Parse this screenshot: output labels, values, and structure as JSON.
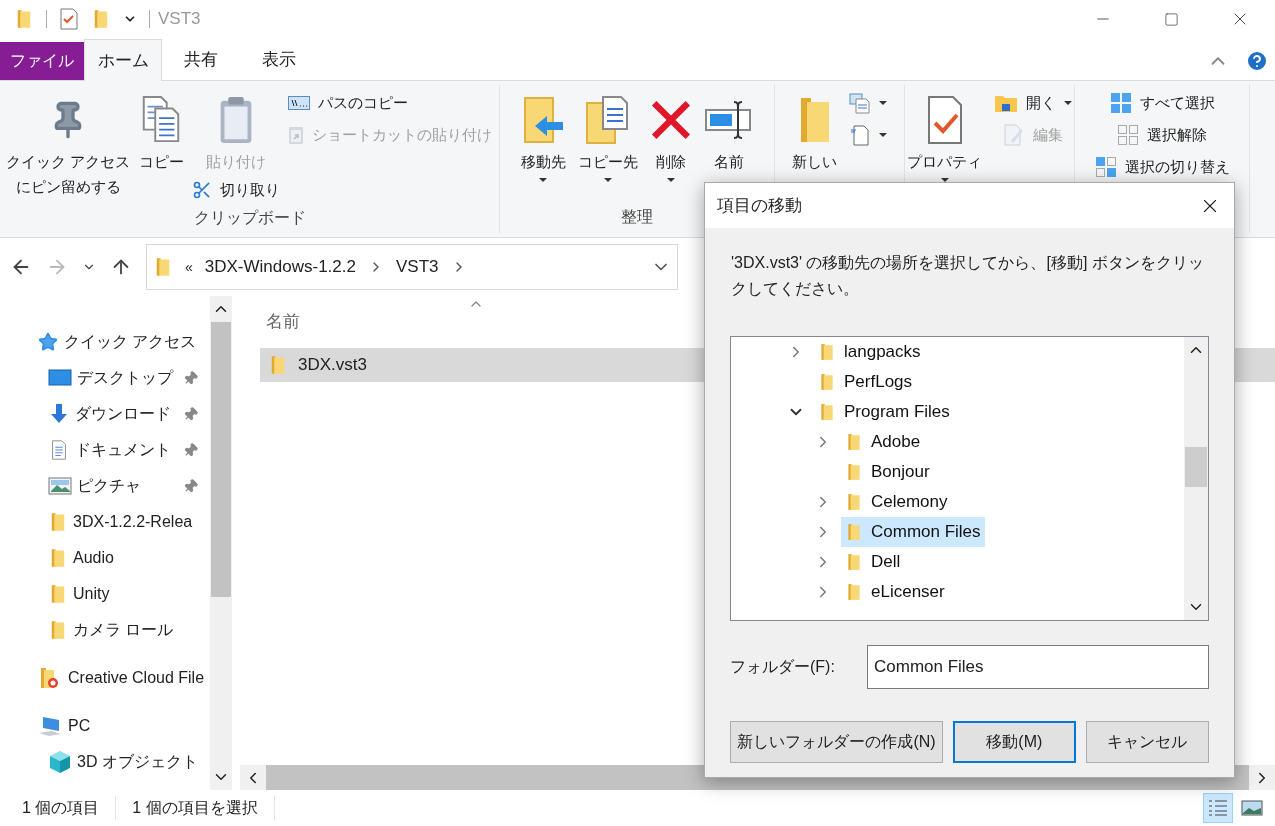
{
  "window": {
    "title": "VST3"
  },
  "tabs": [
    {
      "label": "ファイル",
      "kind": "file",
      "selected": false
    },
    {
      "label": "ホーム",
      "kind": "tab",
      "selected": true
    },
    {
      "label": "共有",
      "kind": "tab",
      "selected": false
    },
    {
      "label": "表示",
      "kind": "tab",
      "selected": false
    }
  ],
  "ribbon": [
    {
      "label": "クリップボード",
      "columns": [
        [
          {
            "kind": "large",
            "lines": [
              "クイック アクセス",
              "にピン留めする"
            ],
            "disabled": false,
            "dropdown": false
          }
        ],
        [
          {
            "kind": "large",
            "lines": [
              "コピー"
            ],
            "disabled": false,
            "dropdown": false
          }
        ],
        [
          {
            "kind": "large",
            "lines": [
              "貼り付け"
            ],
            "disabled": true,
            "dropdown": false
          },
          {
            "kind": "small",
            "lines": [
              "切り取り"
            ],
            "disabled": false,
            "dropdown": false
          }
        ],
        [
          {
            "kind": "small",
            "lines": [
              "パスのコピー"
            ],
            "disabled": false,
            "dropdown": false
          },
          {
            "kind": "small",
            "lines": [
              "ショートカットの貼り付け"
            ],
            "disabled": true,
            "dropdown": false
          }
        ]
      ]
    },
    {
      "label": "整理",
      "columns": [
        [
          {
            "kind": "large",
            "lines": [
              "移動先"
            ],
            "disabled": false,
            "dropdown": true
          }
        ],
        [
          {
            "kind": "large",
            "lines": [
              "コピー先"
            ],
            "disabled": false,
            "dropdown": true
          }
        ],
        [
          {
            "kind": "large",
            "lines": [
              "削除"
            ],
            "disabled": false,
            "dropdown": true
          }
        ],
        [
          {
            "kind": "large",
            "lines": [
              "名前"
            ],
            "disabled": false,
            "dropdown": false
          }
        ]
      ]
    },
    {
      "columns": [
        [
          {
            "kind": "large",
            "lines": [
              "新しい"
            ],
            "disabled": false,
            "dropdown": false
          }
        ],
        [
          {
            "kind": "small",
            "disabled": false,
            "dropdown": true
          },
          {
            "kind": "small",
            "disabled": false,
            "dropdown": true
          }
        ]
      ]
    },
    {
      "columns": [
        [
          {
            "kind": "large",
            "lines": [
              "プロパティ"
            ],
            "disabled": false,
            "dropdown": true
          }
        ],
        [
          {
            "kind": "small",
            "lines": [
              "開く"
            ],
            "disabled": false,
            "dropdown": true
          },
          {
            "kind": "small",
            "lines": [
              "編集"
            ],
            "disabled": true,
            "dropdown": false
          }
        ]
      ]
    },
    {
      "columns": [
        [
          {
            "kind": "small",
            "lines": [
              "すべて選択"
            ],
            "disabled": false,
            "dropdown": false
          },
          {
            "kind": "small",
            "lines": [
              "選択解除"
            ],
            "disabled": false,
            "dropdown": false
          },
          {
            "kind": "small",
            "lines": [
              "選択の切り替え"
            ],
            "disabled": false,
            "dropdown": false
          }
        ]
      ]
    }
  ],
  "address": {
    "overflow": "«",
    "crumbs": [
      "3DX-Windows-1.2.2",
      "VST3"
    ]
  },
  "navigation": [
    {
      "label": "クイック アクセス",
      "children": [
        {
          "label": "デスクトップ",
          "pinned": true
        },
        {
          "label": "ダウンロード",
          "pinned": true
        },
        {
          "label": "ドキュメント",
          "pinned": true
        },
        {
          "label": "ピクチャ",
          "pinned": true
        },
        {
          "label": "3DX-1.2.2-Relea",
          "pinned": false
        },
        {
          "label": "Audio",
          "pinned": false
        },
        {
          "label": "Unity",
          "pinned": false
        },
        {
          "label": "カメラ ロール",
          "pinned": false
        }
      ]
    },
    {
      "label": "Creative Cloud File"
    },
    {
      "label": "PC",
      "children": [
        {
          "label": "3D オブジェクト",
          "pinned": false
        }
      ]
    }
  ],
  "files": {
    "column": "名前",
    "rows": [
      {
        "name": "3DX.vst3",
        "selected": true
      }
    ]
  },
  "status_bar": [
    "1 個の項目",
    "1 個の項目を選択"
  ],
  "views": [
    {
      "kind": "details",
      "selected": true
    },
    {
      "kind": "large_icons",
      "selected": false
    }
  ],
  "dialog": {
    "title": "項目の移動",
    "message": "'3DX.vst3' の移動先の場所を選択してから、[移動] ボタンをクリックしてください。",
    "tree": [
      {
        "label": "langpacks",
        "has_children": true,
        "expanded": false,
        "selected": false
      },
      {
        "label": "PerfLogs",
        "has_children": false,
        "expanded": false,
        "selected": false
      },
      {
        "label": "Program Files",
        "has_children": true,
        "expanded": true,
        "selected": false,
        "children": [
          {
            "label": "Adobe",
            "has_children": true,
            "expanded": false,
            "selected": false
          },
          {
            "label": "Bonjour",
            "has_children": false,
            "expanded": false,
            "selected": false
          },
          {
            "label": "Celemony",
            "has_children": true,
            "expanded": false,
            "selected": false
          },
          {
            "label": "Common Files",
            "has_children": true,
            "expanded": false,
            "selected": true
          },
          {
            "label": "Dell",
            "has_children": true,
            "expanded": false,
            "selected": false
          },
          {
            "label": "eLicenser",
            "has_children": true,
            "expanded": false,
            "selected": false
          }
        ]
      }
    ],
    "folder_label": "フォルダー(F):",
    "folder_value": "Common Files",
    "buttons": [
      {
        "label": "新しいフォルダーの作成(N)",
        "default": false
      },
      {
        "label": "移動(M)",
        "default": true
      },
      {
        "label": "キャンセル",
        "default": false
      }
    ]
  }
}
